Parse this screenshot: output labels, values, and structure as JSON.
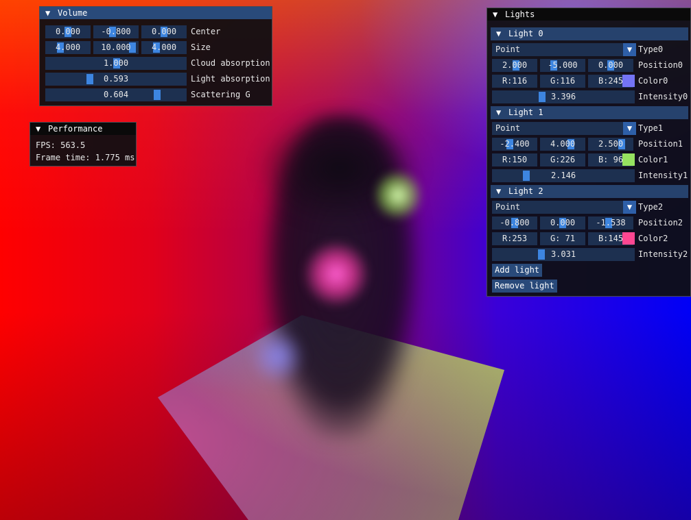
{
  "volume": {
    "title": "Volume",
    "center": {
      "label": "Center",
      "x": "0.000",
      "y": "-0.800",
      "z": "0.000"
    },
    "size": {
      "label": "Size",
      "x": "4.000",
      "y": "10.000",
      "z": "4.000"
    },
    "cloud_absorption": {
      "label": "Cloud absorption",
      "value": "1.000"
    },
    "light_absorption": {
      "label": "Light absorption",
      "value": "0.593"
    },
    "scattering_g": {
      "label": "Scattering G",
      "value": "0.604"
    }
  },
  "performance": {
    "title": "Performance",
    "fps": "FPS: 563.5",
    "frame_time": "Frame time: 1.775 ms"
  },
  "lights": {
    "title": "Lights",
    "items": [
      {
        "header": "Light 0",
        "type": "Point",
        "type_label": "Type0",
        "position": {
          "x": "2.000",
          "y": "-5.000",
          "z": "0.000",
          "label": "Position0"
        },
        "color": {
          "r": "R:116",
          "g": "G:116",
          "b": "B:245",
          "label": "Color0",
          "swatch": "#7474f5"
        },
        "intensity": {
          "value": "3.396",
          "label": "Intensity0"
        }
      },
      {
        "header": "Light 1",
        "type": "Point",
        "type_label": "Type1",
        "position": {
          "x": "-2.400",
          "y": "4.000",
          "z": "2.500",
          "label": "Position1"
        },
        "color": {
          "r": "R:150",
          "g": "G:226",
          "b": "B: 96",
          "label": "Color1",
          "swatch": "#96e260"
        },
        "intensity": {
          "value": "2.146",
          "label": "Intensity1"
        }
      },
      {
        "header": "Light 2",
        "type": "Point",
        "type_label": "Type2",
        "position": {
          "x": "-0.800",
          "y": "0.000",
          "z": "-1.538",
          "label": "Position2"
        },
        "color": {
          "r": "R:253",
          "g": "G: 71",
          "b": "B:145",
          "label": "Color2",
          "swatch": "#fd4791"
        },
        "intensity": {
          "value": "3.031",
          "label": "Intensity2"
        }
      }
    ],
    "add_label": "Add light",
    "remove_label": "Remove light"
  },
  "icons": {
    "collapse": "collapse-triangle-icon",
    "dropdown": "combo-arrow-icon"
  },
  "colors": {
    "title_active": "#294a7a",
    "field_bg": "#1d3050",
    "grab": "#3d85e0",
    "header": "#26426d"
  }
}
